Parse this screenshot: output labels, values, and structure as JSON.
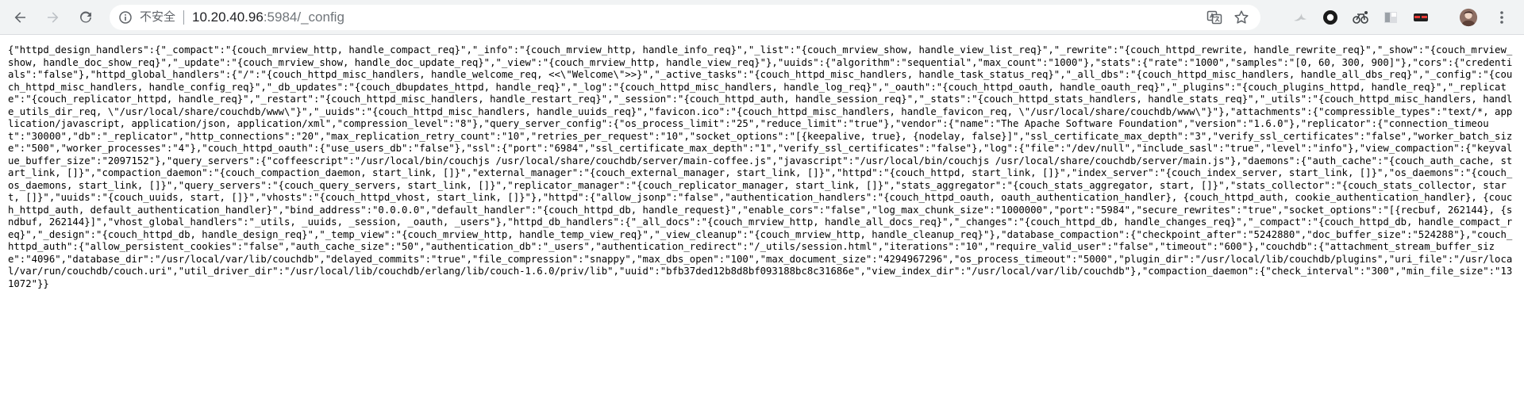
{
  "browser": {
    "security_label": "不安全",
    "url_host": "10.20.40.96",
    "url_rest": ":5984/_config",
    "icons": {
      "back": "back-arrow-icon",
      "forward": "forward-arrow-icon",
      "reload": "reload-icon",
      "info": "info-icon",
      "translate": "translate-icon",
      "bookmark": "star-icon"
    },
    "accent": "#5f6368"
  },
  "content": {
    "text": "{\"httpd_design_handlers\":{\"_compact\":\"{couch_mrview_http, handle_compact_req}\",\"_info\":\"{couch_mrview_http, handle_info_req}\",\"_list\":\"{couch_mrview_show, handle_view_list_req}\",\"_rewrite\":\"{couch_httpd_rewrite, handle_rewrite_req}\",\"_show\":\"{couch_mrview_show, handle_doc_show_req}\",\"_update\":\"{couch_mrview_show, handle_doc_update_req}\",\"_view\":\"{couch_mrview_http, handle_view_req}\"},\"uuids\":{\"algorithm\":\"sequential\",\"max_count\":\"1000\"},\"stats\":{\"rate\":\"1000\",\"samples\":\"[0, 60, 300, 900]\"},\"cors\":{\"credentials\":\"false\"},\"httpd_global_handlers\":{\"/\":\"{couch_httpd_misc_handlers, handle_welcome_req, <<\\\"Welcome\\\">>}\",\"_active_tasks\":\"{couch_httpd_misc_handlers, handle_task_status_req}\",\"_all_dbs\":\"{couch_httpd_misc_handlers, handle_all_dbs_req}\",\"_config\":\"{couch_httpd_misc_handlers, handle_config_req}\",\"_db_updates\":\"{couch_dbupdates_httpd, handle_req}\",\"_log\":\"{couch_httpd_misc_handlers, handle_log_req}\",\"_oauth\":\"{couch_httpd_oauth, handle_oauth_req}\",\"_plugins\":\"{couch_plugins_httpd, handle_req}\",\"_replicate\":\"{couch_replicator_httpd, handle_req}\",\"_restart\":\"{couch_httpd_misc_handlers, handle_restart_req}\",\"_session\":\"{couch_httpd_auth, handle_session_req}\",\"_stats\":\"{couch_httpd_stats_handlers, handle_stats_req}\",\"_utils\":\"{couch_httpd_misc_handlers, handle_utils_dir_req, \\\"/usr/local/share/couchdb/www\\\"}\",\"_uuids\":\"{couch_httpd_misc_handlers, handle_uuids_req}\",\"favicon.ico\":\"{couch_httpd_misc_handlers, handle_favicon_req, \\\"/usr/local/share/couchdb/www\\\"}\"},\"attachments\":{\"compressible_types\":\"text/*, application/javascript, application/json, application/xml\",\"compression_level\":\"8\"},\"query_server_config\":{\"os_process_limit\":\"25\",\"reduce_limit\":\"true\"},\"vendor\":{\"name\":\"The Apache Software Foundation\",\"version\":\"1.6.0\"},\"replicator\":{\"connection_timeout\":\"30000\",\"db\":\"_replicator\",\"http_connections\":\"20\",\"max_replication_retry_count\":\"10\",\"retries_per_request\":\"10\",\"socket_options\":\"[{keepalive, true}, {nodelay, false}]\",\"ssl_certificate_max_depth\":\"3\",\"verify_ssl_certificates\":\"false\",\"worker_batch_size\":\"500\",\"worker_processes\":\"4\"},\"couch_httpd_oauth\":{\"use_users_db\":\"false\"},\"ssl\":{\"port\":\"6984\",\"ssl_certificate_max_depth\":\"1\",\"verify_ssl_certificates\":\"false\"},\"log\":{\"file\":\"/dev/null\",\"include_sasl\":\"true\",\"level\":\"info\"},\"view_compaction\":{\"keyvalue_buffer_size\":\"2097152\"},\"query_servers\":{\"coffeescript\":\"/usr/local/bin/couchjs /usr/local/share/couchdb/server/main-coffee.js\",\"javascript\":\"/usr/local/bin/couchjs /usr/local/share/couchdb/server/main.js\"},\"daemons\":{\"auth_cache\":\"{couch_auth_cache, start_link, []}\",\"compaction_daemon\":\"{couch_compaction_daemon, start_link, []}\",\"external_manager\":\"{couch_external_manager, start_link, []}\",\"httpd\":\"{couch_httpd, start_link, []}\",\"index_server\":\"{couch_index_server, start_link, []}\",\"os_daemons\":\"{couch_os_daemons, start_link, []}\",\"query_servers\":\"{couch_query_servers, start_link, []}\",\"replicator_manager\":\"{couch_replicator_manager, start_link, []}\",\"stats_aggregator\":\"{couch_stats_aggregator, start, []}\",\"stats_collector\":\"{couch_stats_collector, start, []}\",\"uuids\":\"{couch_uuids, start, []}\",\"vhosts\":\"{couch_httpd_vhost, start_link, []}\"},\"httpd\":{\"allow_jsonp\":\"false\",\"authentication_handlers\":\"{couch_httpd_oauth, oauth_authentication_handler}, {couch_httpd_auth, cookie_authentication_handler}, {couch_httpd_auth, default_authentication_handler}\",\"bind_address\":\"0.0.0.0\",\"default_handler\":\"{couch_httpd_db, handle_request}\",\"enable_cors\":\"false\",\"log_max_chunk_size\":\"1000000\",\"port\":\"5984\",\"secure_rewrites\":\"true\",\"socket_options\":\"[{recbuf, 262144}, {sndbuf, 262144}]\",\"vhost_global_handlers\":\"_utils, _uuids, _session, _oauth, _users\"},\"httpd_db_handlers\":{\"_all_docs\":\"{couch_mrview_http, handle_all_docs_req}\",\"_changes\":\"{couch_httpd_db, handle_changes_req}\",\"_compact\":\"{couch_httpd_db, handle_compact_req}\",\"_design\":\"{couch_httpd_db, handle_design_req}\",\"_temp_view\":\"{couch_mrview_http, handle_temp_view_req}\",\"_view_cleanup\":\"{couch_mrview_http, handle_cleanup_req}\"},\"database_compaction\":{\"checkpoint_after\":\"5242880\",\"doc_buffer_size\":\"524288\"},\"couch_httpd_auth\":{\"allow_persistent_cookies\":\"false\",\"auth_cache_size\":\"50\",\"authentication_db\":\"_users\",\"authentication_redirect\":\"/_utils/session.html\",\"iterations\":\"10\",\"require_valid_user\":\"false\",\"timeout\":\"600\"},\"couchdb\":{\"attachment_stream_buffer_size\":\"4096\",\"database_dir\":\"/usr/local/var/lib/couchdb\",\"delayed_commits\":\"true\",\"file_compression\":\"snappy\",\"max_dbs_open\":\"100\",\"max_document_size\":\"4294967296\",\"os_process_timeout\":\"5000\",\"plugin_dir\":\"/usr/local/lib/couchdb/plugins\",\"uri_file\":\"/usr/local/var/run/couchdb/couch.uri\",\"util_driver_dir\":\"/usr/local/lib/couchdb/erlang/lib/couch-1.6.0/priv/lib\",\"uuid\":\"bfb37ded12b8d8bf093188bc8c31686e\",\"view_index_dir\":\"/usr/local/var/lib/couchdb\"},\"compaction_daemon\":{\"check_interval\":\"300\",\"min_file_size\":\"131072\"}}"
  }
}
